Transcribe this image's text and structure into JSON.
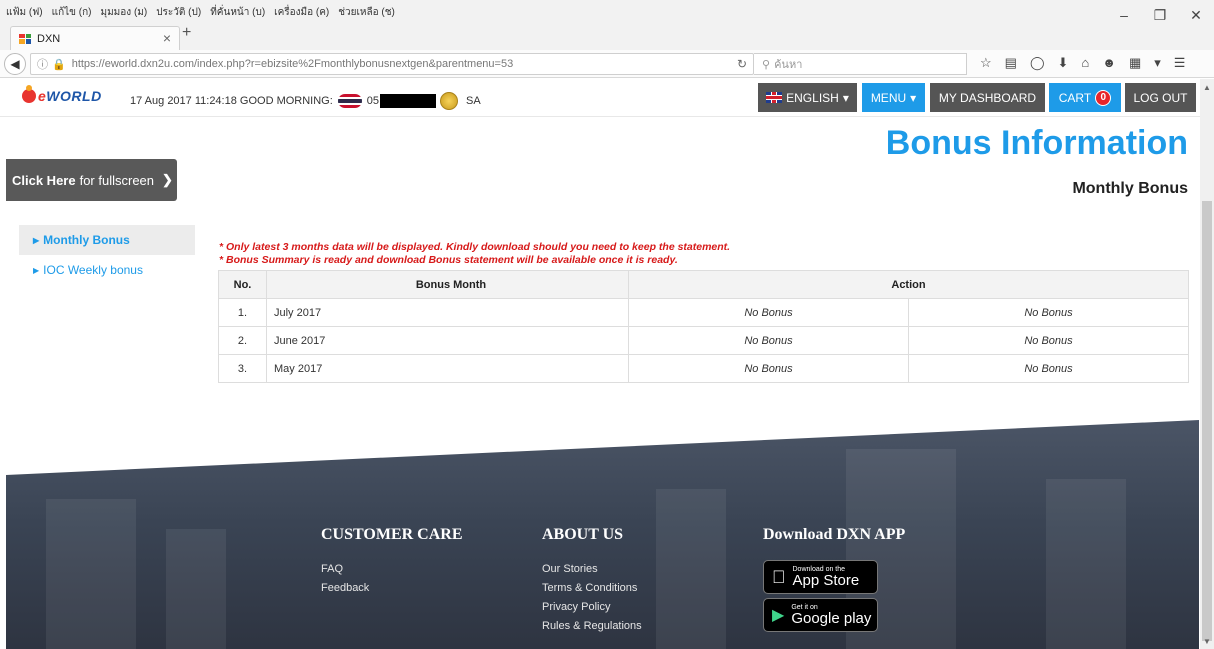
{
  "browser": {
    "menu_items": [
      "แฟ้ม (ฟ)",
      "แก้ไข (ก)",
      "มุมมอง (ม)",
      "ประวัติ (ป)",
      "ที่คั่นหน้า (บ)",
      "เครื่องมือ (ค)",
      "ช่วยเหลือ (ช)"
    ],
    "tab_title": "DXN",
    "url": "https://eworld.dxn2u.com/index.php?r=ebizsite%2Fmonthlybonusnextgen&parentmenu=53",
    "search_placeholder": "ค้นหา"
  },
  "header": {
    "logo_e": "e",
    "logo_world": "WORLD",
    "datetime": "17 Aug 2017 11:24:18",
    "greeting": "GOOD MORNING:",
    "member_id_prefix": "05",
    "member_suffix": "SA",
    "lang_label": "ENGLISH",
    "menu_label": "MENU",
    "dashboard_label": "MY DASHBOARD",
    "cart_label": "CART",
    "cart_count": "0",
    "logout_label": "LOG OUT"
  },
  "page": {
    "title": "Bonus Information",
    "subtitle": "Monthly Bonus",
    "fullscreen_bold": "Click Here",
    "fullscreen_rest": "for fullscreen"
  },
  "sidebar": {
    "items": [
      {
        "label": "Monthly Bonus",
        "active": true
      },
      {
        "label": "IOC Weekly bonus",
        "active": false
      }
    ]
  },
  "notes": [
    "* Only latest 3 months data will be displayed. Kindly download should you need to keep the statement.",
    "* Bonus Summary is ready and download Bonus statement will be available once it is ready."
  ],
  "table": {
    "headers": {
      "no": "No.",
      "month": "Bonus Month",
      "action": "Action"
    },
    "rows": [
      {
        "no": "1.",
        "month": "July 2017",
        "a1": "No Bonus",
        "a2": "No Bonus"
      },
      {
        "no": "2.",
        "month": "June 2017",
        "a1": "No Bonus",
        "a2": "No Bonus"
      },
      {
        "no": "3.",
        "month": "May 2017",
        "a1": "No Bonus",
        "a2": "No Bonus"
      }
    ]
  },
  "footer": {
    "customer_care": {
      "title": "CUSTOMER CARE",
      "links": [
        "FAQ",
        "Feedback"
      ]
    },
    "about_us": {
      "title": "ABOUT US",
      "links": [
        "Our Stories",
        "Terms & Conditions",
        "Privacy Policy",
        "Rules & Regulations"
      ]
    },
    "app": {
      "title": "Download DXN APP",
      "appstore_small": "Download on the",
      "appstore_big": "App Store",
      "gplay_small": "Get it on",
      "gplay_big": "Google play"
    }
  },
  "colors": {
    "accent": "#1e9be8",
    "dark_button": "#555555",
    "note_red": "#d71a1a"
  }
}
